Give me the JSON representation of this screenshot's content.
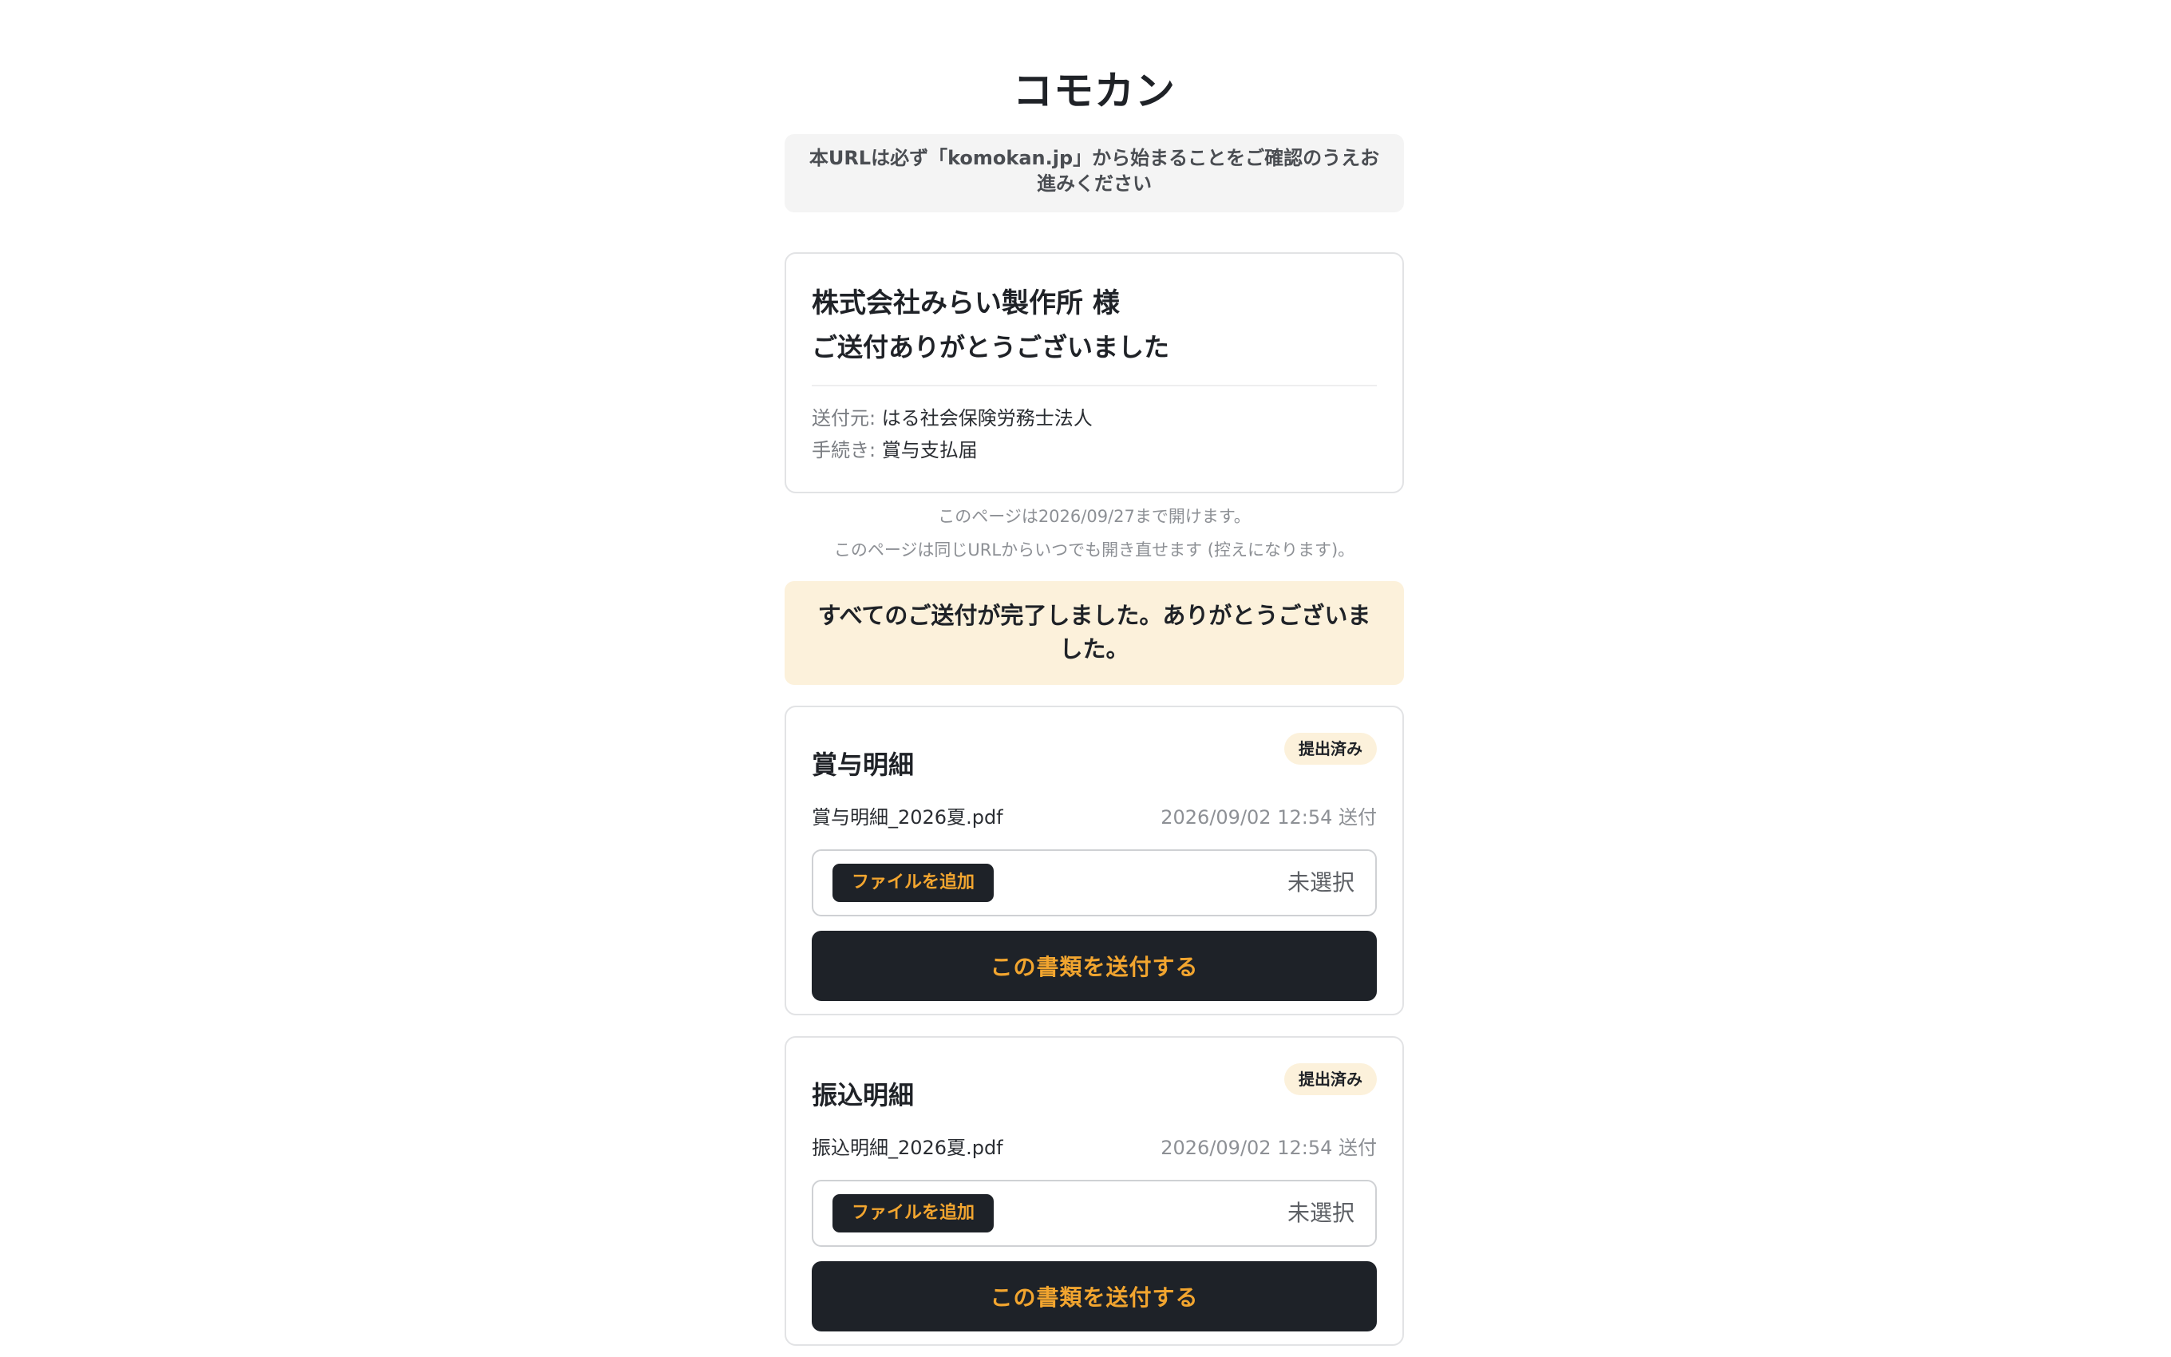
{
  "header": {
    "title": "コモカン",
    "url_notice": "本URLは必ず「komokan.jp」から始まることをご確認のうえお進みください"
  },
  "info": {
    "company": "株式会社みらい製作所 様",
    "thanks": "ご送付ありがとうございました",
    "sender_label": "送付元:",
    "sender_value": "はる社会保険労務士法人",
    "procedure_label": "手続き:",
    "procedure_value": "賞与支払届"
  },
  "expiry": {
    "line1": "このページは2026/09/27まで開けます。",
    "line2": "このページは同じURLからいつでも開き直せます (控えになります)。"
  },
  "banner": {
    "complete": "すべてのご送付が完了しました。ありがとうございました。"
  },
  "documents": [
    {
      "title": "賞与明細",
      "status": "提出済み",
      "file_name": "賞与明細_2026夏.pdf",
      "sent_at": "2026/09/02 12:54 送付",
      "add_file_label": "ファイルを追加",
      "picker_status": "未選択",
      "send_label": "この書類を送付する"
    },
    {
      "title": "振込明細",
      "status": "提出済み",
      "file_name": "振込明細_2026夏.pdf",
      "sent_at": "2026/09/02 12:54 送付",
      "add_file_label": "ファイルを追加",
      "picker_status": "未選択",
      "send_label": "この書類を送付する"
    }
  ],
  "colors": {
    "accent": "#f2a52f",
    "dark": "#1e2228",
    "banner_bg": "#fcf1db",
    "notice_bg": "#f4f4f4"
  }
}
